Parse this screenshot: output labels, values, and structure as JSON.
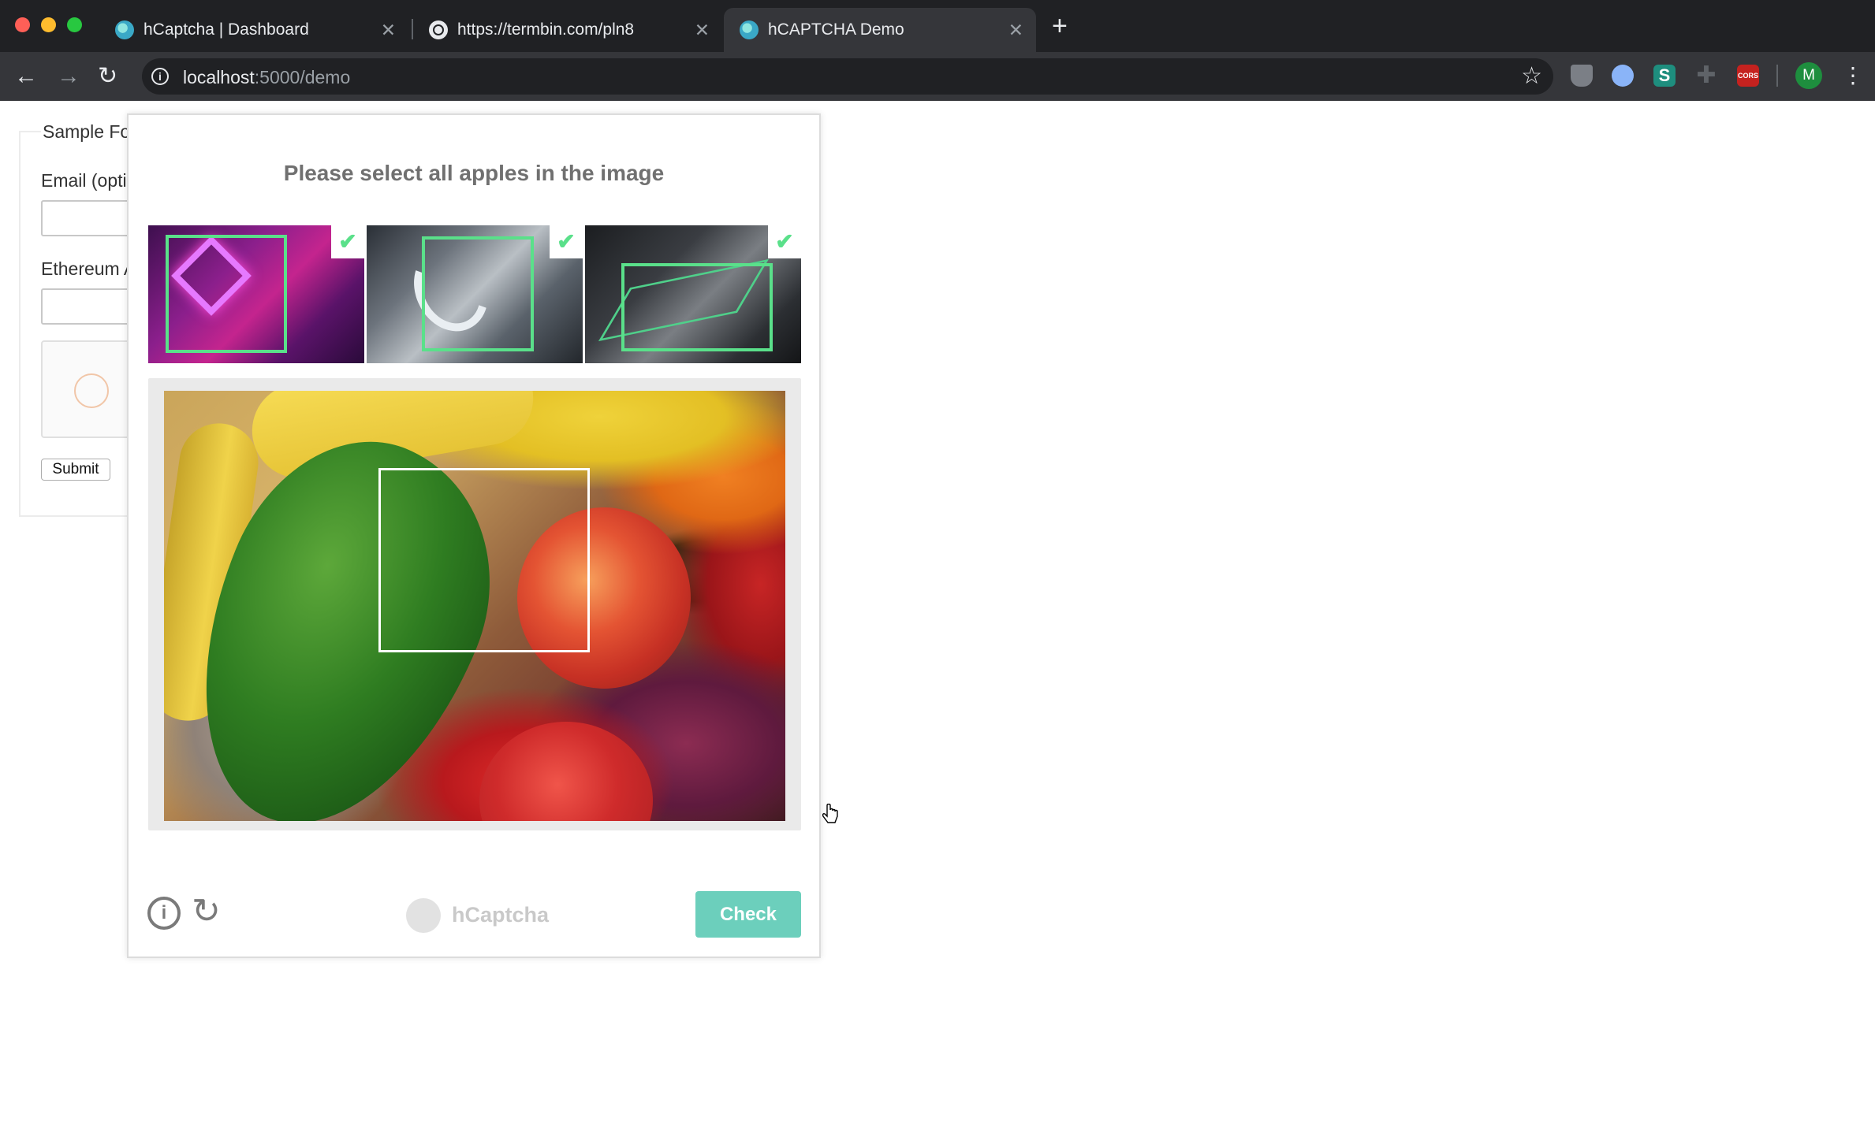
{
  "browser": {
    "tabs": [
      {
        "title": "hCaptcha | Dashboard",
        "close": "✕"
      },
      {
        "title": "https://termbin.com/pln8",
        "close": "✕"
      },
      {
        "title": "hCAPTCHA Demo",
        "close": "✕"
      }
    ],
    "new_tab": "+",
    "url_host": "localhost",
    "url_rest": ":5000/demo",
    "avatar_letter": "M",
    "ext_s_label": "S",
    "ext_cors_label": "CORS"
  },
  "form": {
    "legend": "Sample Fo",
    "email_label": "Email (opti",
    "ethereum_label": "Ethereum A",
    "submit_label": "Submit"
  },
  "challenge": {
    "prompt": "Please select all apples in the image",
    "examples": [
      {
        "checked": true,
        "check_glyph": "✔"
      },
      {
        "checked": true,
        "check_glyph": "✔"
      },
      {
        "checked": true,
        "check_glyph": "✔"
      }
    ],
    "brand": "hCaptcha",
    "check_label": "Check"
  },
  "colors": {
    "accent_check": "#6ccfbc",
    "example_frame": "#5ae08a"
  },
  "icons": [
    "back-arrow-icon",
    "forward-arrow-icon",
    "reload-icon",
    "info-icon",
    "star-icon",
    "refresh-icon",
    "info-circle-icon",
    "hcaptcha-logo-icon",
    "hand-cursor-icon"
  ]
}
